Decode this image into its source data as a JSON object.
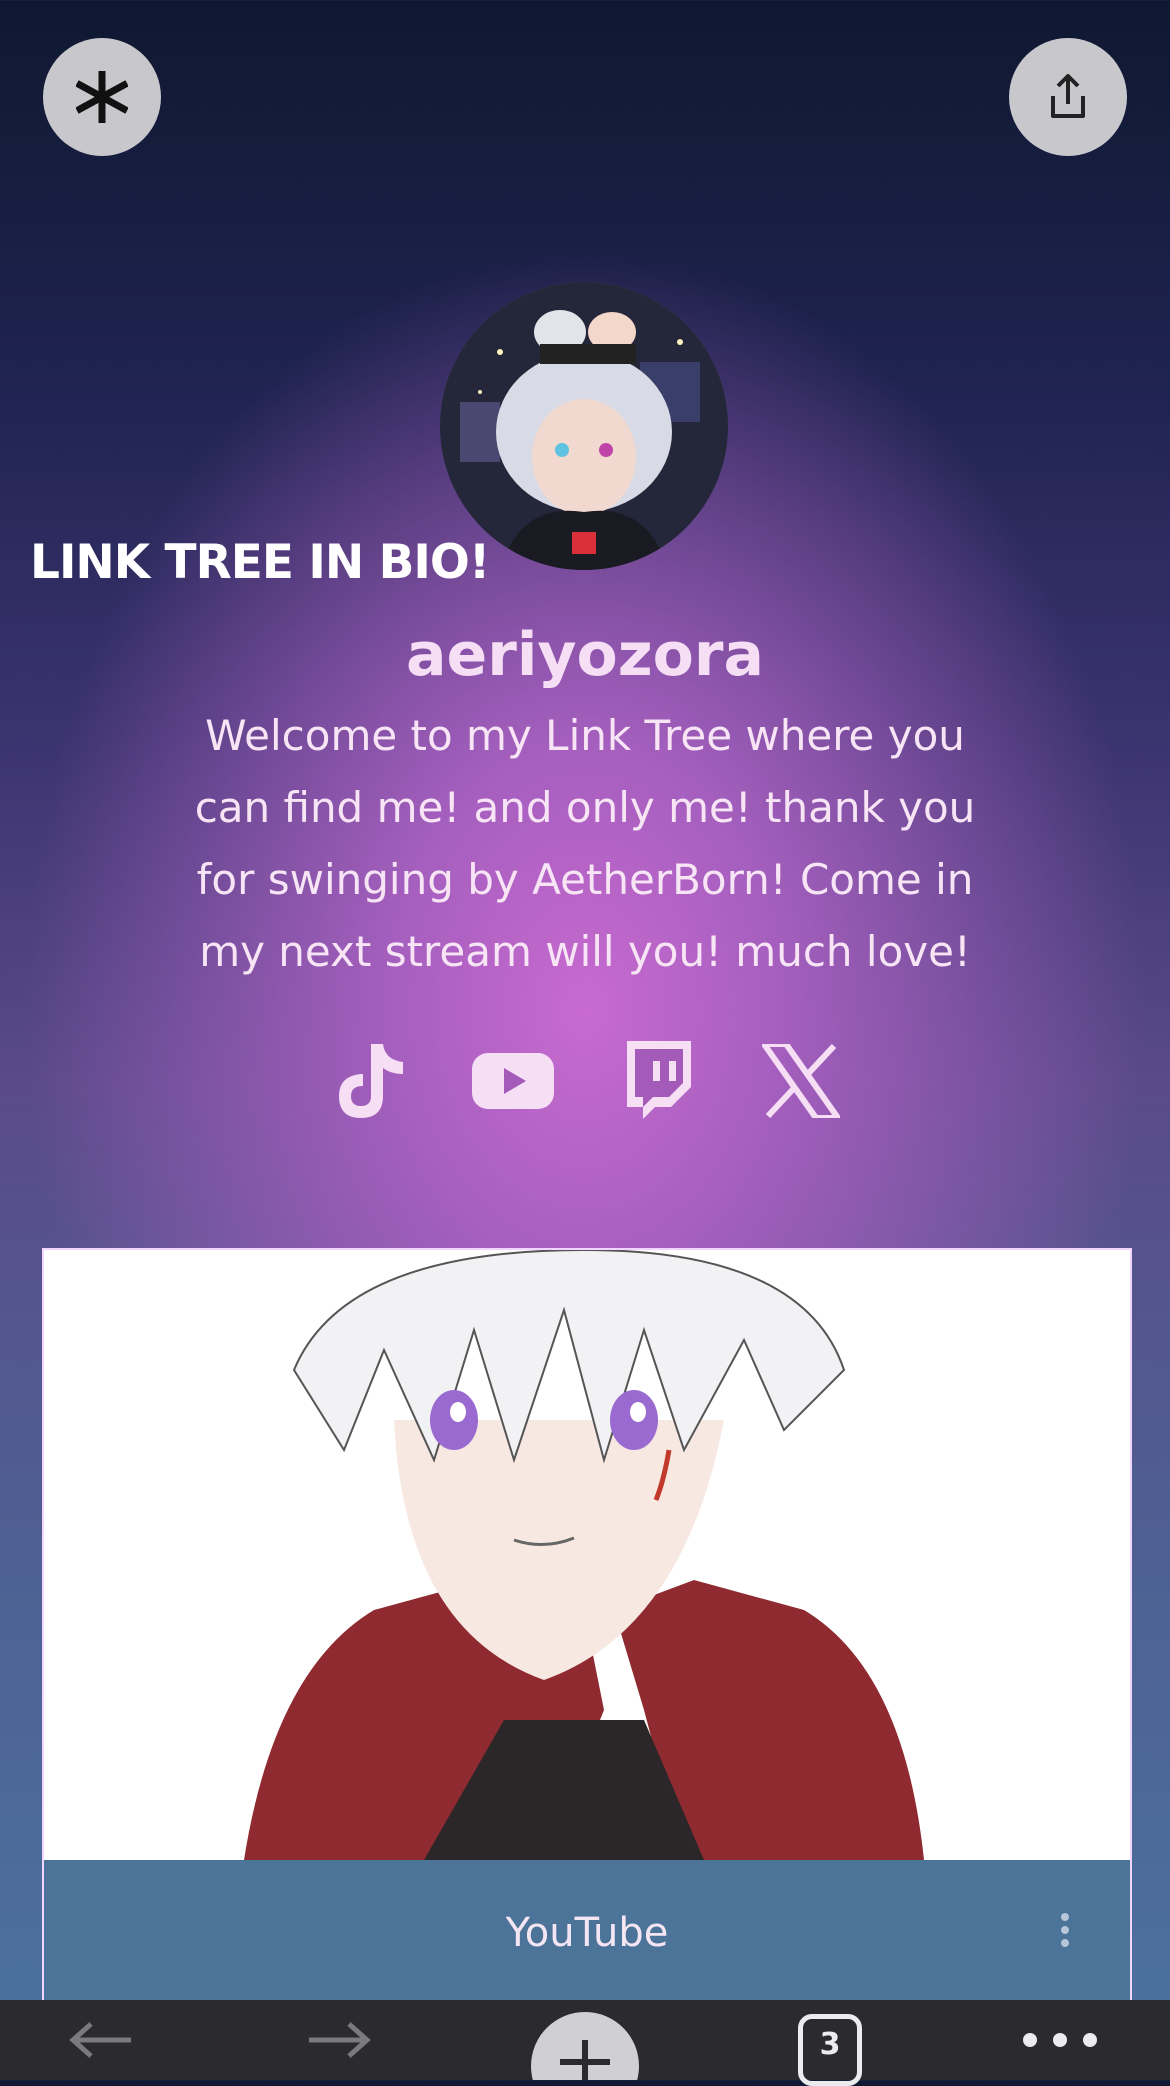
{
  "overlay_caption": "LINK TREE IN BIO!",
  "profile": {
    "username": "aeriyozora",
    "bio": "Welcome to my Link Tree where you can find me! and only me! thank you for swinging by AetherBorn! Come in my next stream will you! much love!"
  },
  "top_buttons": {
    "left_icon": "linktree-asterisk-icon",
    "right_icon": "share-icon"
  },
  "socials": [
    {
      "name": "TikTok",
      "icon": "tiktok-icon"
    },
    {
      "name": "YouTube",
      "icon": "youtube-icon"
    },
    {
      "name": "Twitch",
      "icon": "twitch-icon"
    },
    {
      "name": "X",
      "icon": "x-icon"
    }
  ],
  "link_card": {
    "title": "YouTube",
    "menu_icon": "more-vertical-icon"
  },
  "browser_bar": {
    "tab_count": "3",
    "items": [
      "back-icon",
      "forward-icon",
      "new-tab-icon",
      "tabs-icon",
      "more-icon"
    ]
  },
  "colors": {
    "accent_pink": "#f6dff5",
    "card_footer": "#4c7398",
    "card_border": "#f3d6ff"
  }
}
